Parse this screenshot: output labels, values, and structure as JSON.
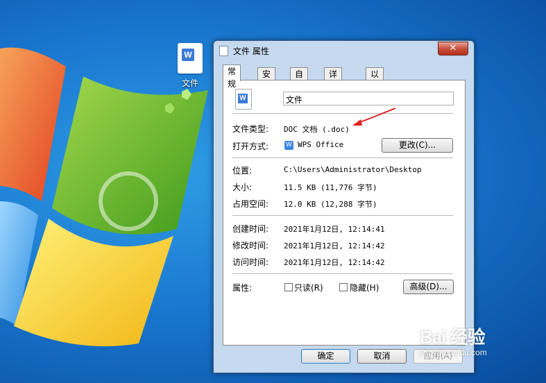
{
  "desktop": {
    "icon_label": "文件",
    "icon_badge": "W"
  },
  "dialog": {
    "title": "文件 属性",
    "close_label": "✕",
    "tabs": [
      {
        "label": "常规"
      },
      {
        "label": "安全"
      },
      {
        "label": "自定义"
      },
      {
        "label": "详细信息"
      },
      {
        "label": "以前的版本"
      }
    ],
    "general": {
      "file_name": "文件",
      "file_icon_badge": "W",
      "type_label": "文件类型:",
      "type_value": "DOC 文档 (.doc)",
      "opens_label": "打开方式:",
      "opens_value": "WPS Office",
      "opens_icon": "W",
      "change_button": "更改(C)...",
      "location_label": "位置:",
      "location_value": "C:\\Users\\Administrator\\Desktop",
      "size_label": "大小:",
      "size_value": "11.5 KB (11,776 字节)",
      "size_on_disk_label": "占用空间:",
      "size_on_disk_value": "12.0 KB (12,288 字节)",
      "created_label": "创建时间:",
      "created_value": "2021年1月12日, 12:14:41",
      "modified_label": "修改时间:",
      "modified_value": "2021年1月12日, 12:14:42",
      "accessed_label": "访问时间:",
      "accessed_value": "2021年1月12日, 12:14:42",
      "attributes_label": "属性:",
      "readonly_label": "只读(R)",
      "hidden_label": "隐藏(H)",
      "advanced_button": "高级(D)..."
    },
    "buttons": {
      "ok": "确定",
      "cancel": "取消",
      "apply": "应用(A)"
    }
  },
  "watermark": {
    "main": "Bai 经验",
    "sub": "jingyan.baidu.com"
  },
  "colors": {
    "annotation_arrow": "#e02020",
    "desktop_blue": "#1a78cf"
  }
}
